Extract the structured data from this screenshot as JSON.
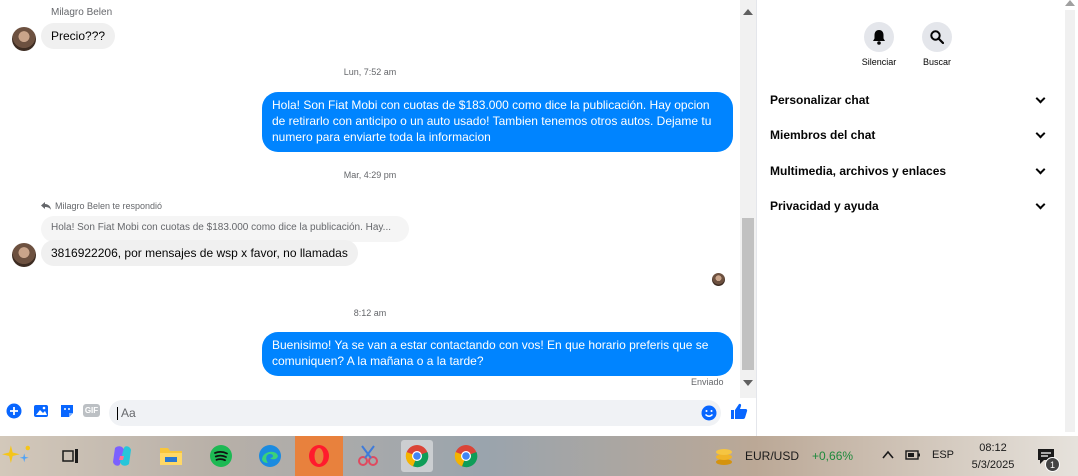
{
  "conversation": {
    "sender_name": "Milagro Belen",
    "msg1": "Precio???",
    "ts1": "Lun, 7:52 am",
    "msg2": "Hola! Son Fiat Mobi con cuotas de $183.000 como dice la publicación. Hay opcion de retirarlo con anticipo o un auto usado! Tambien tenemos otros autos. Dejame tu numero para enviarte toda la informacion",
    "ts2": "Mar, 4:29 pm",
    "reply_header": "Milagro Belen te respondió",
    "quoted": "Hola! Son Fiat Mobi con cuotas de $183.000 como dice la publicación. Hay...",
    "msg3": "3816922206, por mensajes de wsp x favor, no llamadas",
    "ts3": "8:12 am",
    "msg4": "Buenisimo! Ya se van a estar contactando con vos! En que horario preferis que se comuniquen? A la mañana o a la tarde?",
    "status": "Enviado"
  },
  "composer": {
    "placeholder": "Aa",
    "icons": [
      "plus-icon",
      "photo-icon",
      "sticker-icon",
      "gif-icon",
      "emoji-icon",
      "like-icon"
    ],
    "gif_label": "GIF"
  },
  "right_panel": {
    "actions": [
      {
        "label": "Silenciar",
        "icon": "bell-icon"
      },
      {
        "label": "Buscar",
        "icon": "search-icon"
      }
    ],
    "sections": [
      {
        "label": "Personalizar chat"
      },
      {
        "label": "Miembros del chat"
      },
      {
        "label": "Multimedia, archivos y enlaces"
      },
      {
        "label": "Privacidad y ayuda"
      }
    ]
  },
  "taskbar": {
    "apps": [
      "copilot-icon",
      "task-view-icon",
      "copilot-app-icon",
      "file-explorer-icon",
      "spotify-icon",
      "edge-icon",
      "opera-icon",
      "snipping-icon",
      "chrome-icon",
      "chrome-icon-2"
    ],
    "ticker": "EUR/USD",
    "ticker_change": "+0,66%",
    "ticker_color": "#1e8a3c",
    "language": "ESP",
    "time": "08:12",
    "date": "5/3/2025",
    "notification_count": "1"
  },
  "colors": {
    "outgoing_bubble": "#0084ff",
    "incoming_bubble": "#f0f0f0",
    "accent": "#0866ff"
  }
}
